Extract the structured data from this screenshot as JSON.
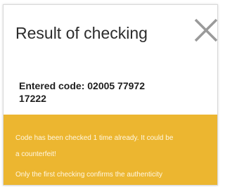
{
  "dialog": {
    "title": "Result of checking",
    "close_icon": "close-x-icon",
    "entered_code_text": "Entered code: 02005 77972 17222"
  },
  "warning": {
    "line1": "Code has been checked 1 time already. It could be",
    "line2": "a counterfeit!",
    "line3": "Only the first checking confirms the authenticity",
    "background_color": "#ecb630"
  }
}
